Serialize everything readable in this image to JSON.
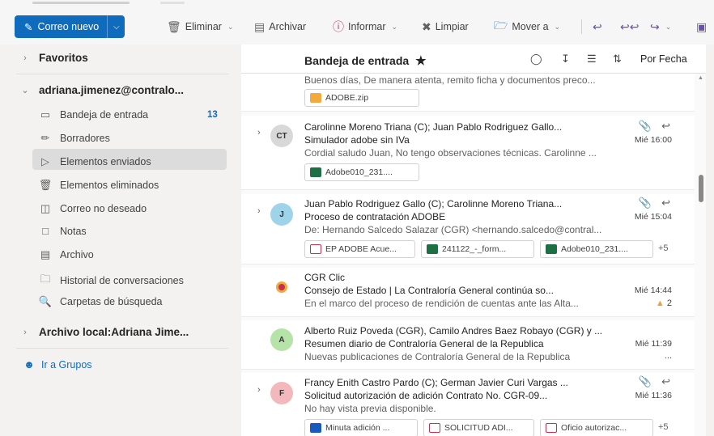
{
  "ribbon": {
    "new_mail": "Correo nuevo",
    "delete": "Eliminar",
    "archive": "Archivar",
    "report": "Informar",
    "sweep": "Limpiar",
    "move": "Mover a"
  },
  "nav": {
    "favorites": "Favoritos",
    "account": "adriana.jimenez@contralo...",
    "folders": [
      {
        "label": "Bandeja de entrada",
        "icon": "inbox-icon",
        "count": "13"
      },
      {
        "label": "Borradores",
        "icon": "pencil-icon"
      },
      {
        "label": "Elementos enviados",
        "icon": "send-icon"
      },
      {
        "label": "Elementos eliminados",
        "icon": "trash-icon"
      },
      {
        "label": "Correo no deseado",
        "icon": "junk-icon"
      },
      {
        "label": "Notas",
        "icon": "note-icon"
      },
      {
        "label": "Archivo",
        "icon": "archive-icon"
      },
      {
        "label": "Historial de conversaciones",
        "icon": "folder-icon"
      },
      {
        "label": "Carpetas de búsqueda",
        "icon": "search-folder-icon"
      }
    ],
    "local_archive": "Archivo local:Adriana Jime...",
    "groups": "Ir a Grupos"
  },
  "list": {
    "title": "Bandeja de entrada",
    "sort": "Por Fecha",
    "messages": [
      {
        "preview": "Buenos días, De manera atenta, remito ficha y documentos preco...",
        "attachments": [
          "ADOBE.zip"
        ]
      },
      {
        "initials": "CT",
        "sender": "Carolinne Moreno Triana (C); Juan Pablo Rodriguez Gallo...",
        "subject": "Simulador adobe sin IVa",
        "time": "Mié 16:00",
        "preview": "Cordial saludo Juan, No tengo observaciones técnicas. Carolinne ...",
        "attachments": [
          "Adobe010_231...."
        ]
      },
      {
        "initials": "J",
        "sender": "Juan Pablo Rodriguez Gallo (C); Carolinne Moreno Triana...",
        "subject": "Proceso de contratación ADOBE",
        "time": "Mié 15:04",
        "preview": "De: Hernando Salcedo Salazar (CGR) <hernando.salcedo@contral...",
        "attachments": [
          "EP ADOBE Acue...",
          "241122_-_form...",
          "Adobe010_231...."
        ],
        "more": "+5"
      },
      {
        "sender": "CGR Clic",
        "subject": "Consejo de Estado | La Contraloría General continúa so...",
        "time": "Mié 14:44",
        "preview": "En el marco del proceso de rendición de cuentas ante las Alta...",
        "likes": "2"
      },
      {
        "initials": "A",
        "sender": "Alberto Ruiz Poveda (CGR), Camilo Andres Baez Robayo (CGR) y ...",
        "subject": "Resumen diario de Contraloría General de la Republica",
        "time": "Mié 11:39",
        "preview": "Nuevas publicaciones de Contraloría General de la Republica",
        "ellipsis": "..."
      },
      {
        "initials": "F",
        "sender": "Francy Enith Castro Pardo (C); German Javier Curi Vargas ...",
        "subject": "Solicitud autorización de adición Contrato No. CGR-09...",
        "time": "Mié 11:36",
        "preview": "No hay vista previa disponible.",
        "attachments": [
          "Minuta adición ...",
          "SOLICITUD ADI...",
          "Oficio autorizac..."
        ],
        "more": "+5"
      }
    ]
  },
  "colors": {
    "accent": "#0f6cbd",
    "avatar_ct": "#d8d8d8",
    "avatar_j": "#9fd3ea",
    "avatar_a": "#b6e3a8",
    "avatar_f": "#f2b8bc"
  }
}
